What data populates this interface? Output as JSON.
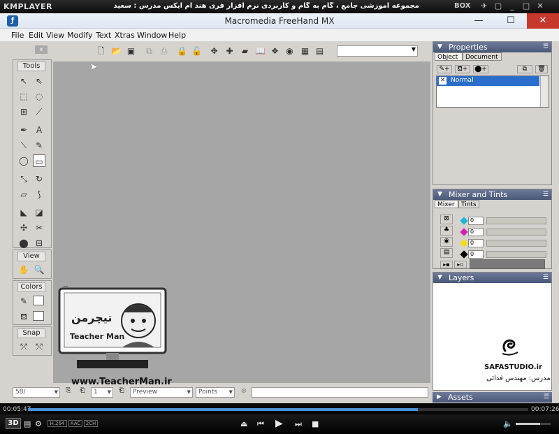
{
  "player": {
    "logo": "KMPLAYER",
    "title": "مجموعه آموزشی جامع ، گام به گام و کاربردی نرم افزار فری هند ام ایکس  مدرس : سعید فدایی ( تیچرمن ) گروه آموزشی پادشاه گرافیست ها",
    "box_label": "BOX",
    "time_elapsed": "00:05:47",
    "time_total": "00:07:26",
    "progress": 0.78,
    "badges": [
      "3D",
      "H.264",
      "AAC",
      "2CH"
    ],
    "volume": 0.7
  },
  "window": {
    "title": "Macromedia FreeHand MX",
    "app_icon": "freehand-icon",
    "controls": [
      "—",
      "☐",
      "✕"
    ]
  },
  "menu": [
    "File",
    "Edit",
    "View",
    "Modify",
    "Text",
    "Xtras",
    "Window",
    "Help"
  ],
  "tools_panel": {
    "close": "x",
    "sections": [
      "Tools",
      "View",
      "Colors",
      "Snap"
    ]
  },
  "properties": {
    "title": "Properties",
    "tabs": [
      "Object",
      "Document"
    ],
    "active_tab": "Object",
    "list_selected": "Normal"
  },
  "mixer": {
    "title": "Mixer and Tints",
    "tabs": [
      "Mixer",
      "Tints"
    ],
    "active_tab": "Mixer",
    "channels": [
      {
        "color": "#19b7d6",
        "value": "0"
      },
      {
        "color": "#d21fb4",
        "value": "0"
      },
      {
        "color": "#f2df0a",
        "value": "0"
      },
      {
        "color": "#000000",
        "value": "0"
      }
    ]
  },
  "layers": {
    "title": "Layers",
    "logo_text": "SAFASTUDIO.ir",
    "logo_caption": "مدرس: مهندس فدائی"
  },
  "assets": {
    "title": "Assets"
  },
  "status": {
    "zoom": "58/",
    "page": "1",
    "view_mode": "Preview",
    "units": "Points"
  },
  "watermark": {
    "brand_fa": "تیچرمن",
    "brand_en": "Teacher Man",
    "url": "www.TeacherMan.ir"
  }
}
